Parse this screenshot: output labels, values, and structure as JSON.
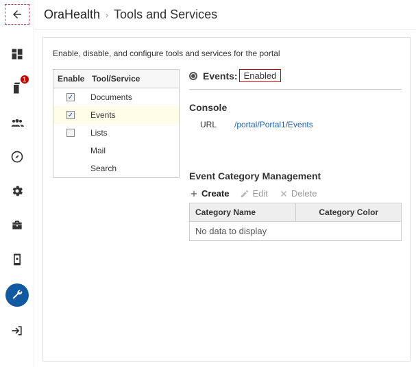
{
  "sidebar": {
    "badge": "1"
  },
  "header": {
    "title": "OraHealth",
    "separator": "›",
    "subtitle": "Tools and Services"
  },
  "intro": "Enable, disable, and configure tools and services for the portal",
  "tools_table": {
    "col_enable": "Enable",
    "col_name": "Tool/Service",
    "items": [
      {
        "name": "Documents",
        "checked": true,
        "selected": false
      },
      {
        "name": "Events",
        "checked": true,
        "selected": true
      },
      {
        "name": "Lists",
        "checked": false,
        "selected": false
      },
      {
        "name": "Mail",
        "checked": null,
        "selected": false
      },
      {
        "name": "Search",
        "checked": null,
        "selected": false
      }
    ]
  },
  "status": {
    "label": "Events:",
    "value": "Enabled"
  },
  "console": {
    "title": "Console",
    "url_label": "URL",
    "url_value": "/portal/Portal1/Events"
  },
  "ecm": {
    "title": "Event Category Management",
    "create": "Create",
    "edit": "Edit",
    "delete": "Delete",
    "col_name": "Category Name",
    "col_color": "Category Color",
    "empty": "No data to display"
  }
}
